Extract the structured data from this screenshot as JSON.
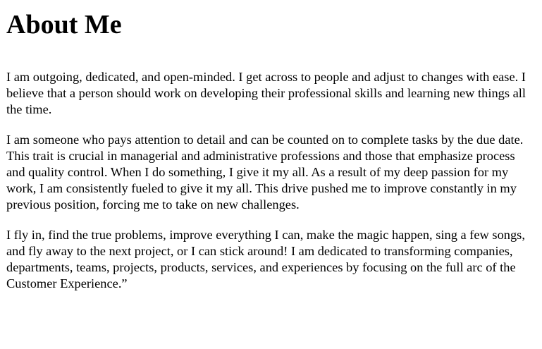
{
  "page": {
    "title": "About Me",
    "paragraphs": [
      "I am outgoing, dedicated, and open-minded. I get across to people and adjust to changes with ease. I believe that a person should work on developing their professional skills and learning new things all the time.",
      "I am someone who pays attention to detail and can be counted on to complete tasks by the due date. This trait is crucial in managerial and administrative professions and those that emphasize process and quality control. When I do something, I give it my all. As a result of my deep passion for my work, I am consistently fueled to give it my all. This drive pushed me to improve constantly in my previous position, forcing me to take on new challenges.",
      "I fly in, find the true problems, improve everything I can, make the magic happen, sing a few songs, and fly away to the next project, or I can stick around! I am dedicated to transforming companies, departments, teams, projects, products, services, and experiences by focusing on the full arc of the Customer Experience.”"
    ]
  }
}
